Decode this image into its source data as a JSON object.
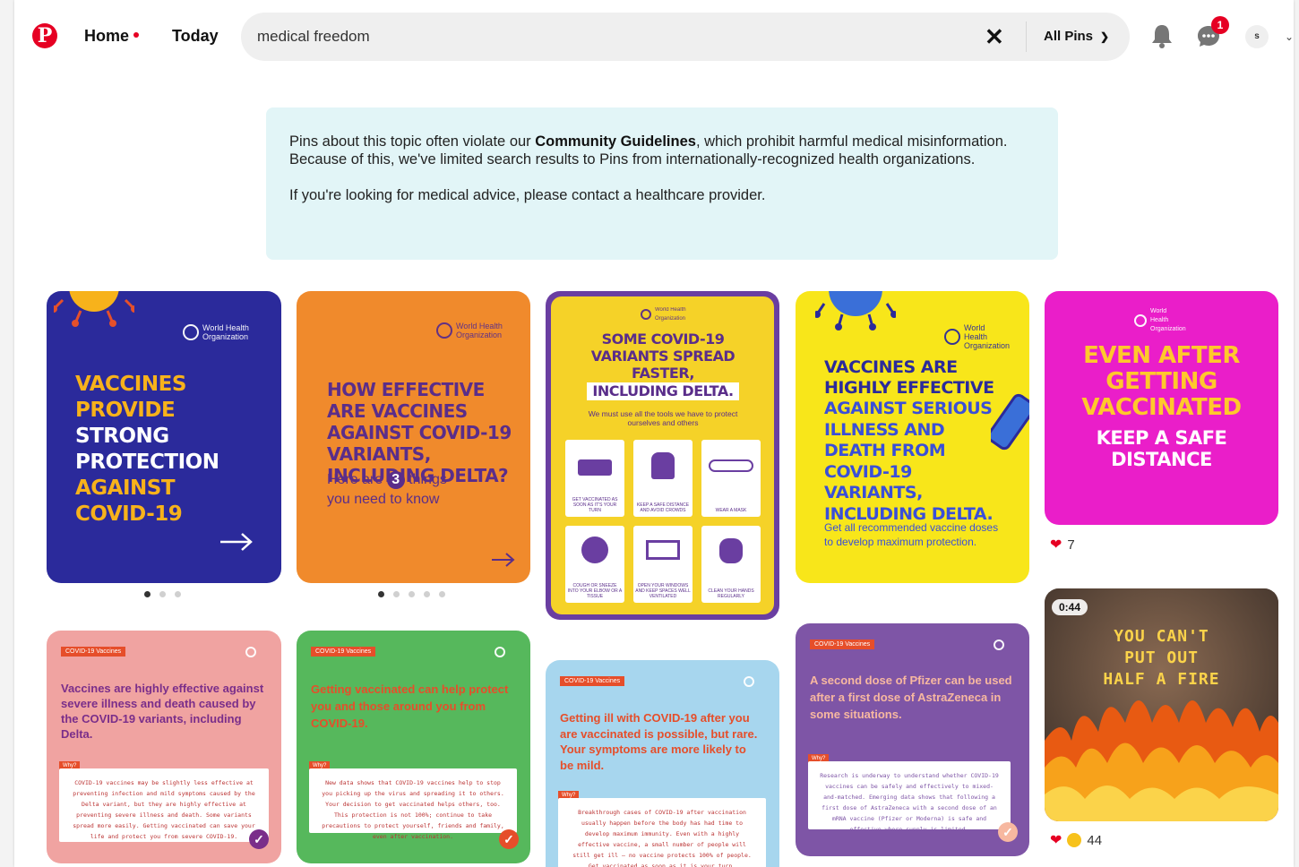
{
  "header": {
    "logo": "P",
    "nav_home": "Home",
    "nav_today": "Today",
    "search_value": "medical freedom",
    "filter_label": "All Pins",
    "notification_count": "1",
    "avatar_initial": "s"
  },
  "notice": {
    "line1_pre": "Pins about this topic often violate our ",
    "line1_bold": "Community Guidelines",
    "line1_post": ", which prohibit harmful medical misinformation. Because of this, we've limited search results to Pins from internationally-recognized health organizations.",
    "line2": "If you're looking for medical advice, please contact a healthcare provider."
  },
  "pins": [
    {
      "id": "p1",
      "org": "World Health Organization",
      "lines": [
        "VACCINES",
        "PROVIDE",
        "STRONG",
        "PROTECTION",
        "AGAINST",
        "COVID-19"
      ],
      "bg": "#2b2a9b"
    },
    {
      "id": "p2",
      "org": "World Health Organization",
      "title": "HOW EFFECTIVE ARE VACCINES AGAINST COVID-19 VARIANTS, INCLUDING DELTA?",
      "sub_pre": "Here are",
      "sub_num": "3",
      "sub_post": "things",
      "sub2": "you need to know",
      "bg": "#f08a2c"
    },
    {
      "id": "p3",
      "org": "World Health Organization",
      "title1": "SOME COVID-19 VARIANTS SPREAD FASTER,",
      "title2": "INCLUDING DELTA.",
      "sub": "We must use all the tools we have to protect ourselves and others",
      "tiles": [
        "GET VACCINATED AS SOON AS IT'S YOUR TURN",
        "KEEP A SAFE DISTANCE AND AVOID CROWDS",
        "WEAR A MASK",
        "COUGH OR SNEEZE INTO YOUR ELBOW OR A TISSUE",
        "OPEN YOUR WINDOWS AND KEEP SPACES WELL VENTILATED",
        "CLEAN YOUR HANDS REGULARLY"
      ],
      "bg": "#f5d228"
    },
    {
      "id": "p4",
      "org": "World Health Organization",
      "title": "VACCINES ARE HIGHLY EFFECTIVE",
      "title_blue": "AGAINST SERIOUS ILLNESS AND DEATH FROM COVID-19 VARIANTS, INCLUDING DELTA.",
      "sub": "Get all recommended vaccine doses to develop maximum protection.",
      "bg": "#f8e61a"
    },
    {
      "id": "p5",
      "org": "World Health Organization",
      "title": "EVEN AFTER GETTING VACCINATED",
      "sub": "KEEP A SAFE DISTANCE",
      "bg": "#ea1ec9",
      "reactions": "7"
    },
    {
      "id": "p6",
      "tag": "COVID-19 Vaccines",
      "title": "Vaccines are highly effective against severe illness and death caused by the COVID-19 variants, including Delta.",
      "why": "Why?",
      "body": "COVID-19 vaccines may be slightly less effective at preventing infection and mild symptoms caused by the Delta variant, but they are highly effective at preventing severe illness and death. Some variants spread more easily. Getting vaccinated can save your life and protect you from severe COVID-19.",
      "bg": "#f0a3a1"
    },
    {
      "id": "p7",
      "tag": "COVID-19 Vaccines",
      "title": "Getting vaccinated can help protect you and those around you from COVID-19.",
      "why": "Why?",
      "body": "New data shows that COVID-19 vaccines help to stop you picking up the virus and spreading it to others. Your decision to get vaccinated helps others, too. This protection is not 100%; continue to take precautions to protect yourself, friends and family, even after vaccination.",
      "bg": "#56b85c"
    },
    {
      "id": "p8",
      "tag": "COVID-19 Vaccines",
      "title": "Getting ill with COVID-19 after you are vaccinated is possible, but rare. Your symptoms are more likely to be mild.",
      "why": "Why?",
      "body": "Breakthrough cases of COVID-19 after vaccination usually happen before the body has had time to develop maximum immunity. Even with a highly effective vaccine, a small number of people will still get ill – no vaccine protects 100% of people. Get vaccinated as soon as it is your turn.",
      "bg": "#a7d6ee"
    },
    {
      "id": "p9",
      "tag": "COVID-19 Vaccines",
      "title": "A second dose of Pfizer can be used after a first dose of AstraZeneca in some situations.",
      "why": "Why?",
      "body": "Research is underway to understand whether COVID-19 vaccines can be safely and effectively to mixed-and-matched. Emerging data shows that following a first dose of AstraZeneca with a second dose of an mRNA vaccine (Pfizer or Moderna) is safe and effective where supply is limited.",
      "bg": "#7e55a6"
    },
    {
      "id": "p10",
      "duration": "0:44",
      "lines": [
        "YOU CAN'T",
        "PUT OUT",
        "HALF A FIRE"
      ],
      "reactions": "44"
    }
  ]
}
